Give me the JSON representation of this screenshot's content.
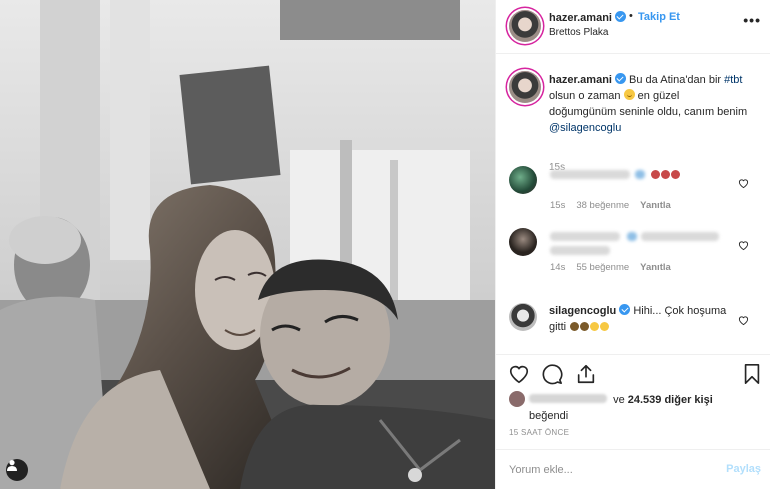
{
  "header": {
    "username": "hazer.amani",
    "separator": "•",
    "follow_label": "Takip Et",
    "location": "Brettos Plaka",
    "more_icon": "more-options-icon"
  },
  "caption": {
    "username": "hazer.amani",
    "text_1": "Bu da Atina'dan bir",
    "hashtag": "#tbt",
    "text_2": "olsun o zaman",
    "text_3": "en güzel doğumgünüm seninle oldu, canım benim",
    "mention": "@silagencoglu",
    "time": "15s"
  },
  "comments": [
    {
      "time": "15s",
      "likes": "38 beğenme",
      "reply": "Yanıtla"
    },
    {
      "time": "14s",
      "likes": "55 beğenme",
      "reply": "Yanıtla"
    },
    {
      "username": "silagencoglu",
      "text": "Hihi... Çok hoşuma gitti"
    }
  ],
  "likes": {
    "conjunction": "ve",
    "count_text": "24.539 diğer kişi",
    "suffix": "beğendi"
  },
  "post_time": "15 SAAT ÖNCE",
  "comment_input": {
    "placeholder": "Yorum ekle..."
  },
  "post_button": "Paylaş",
  "colors": {
    "accent": "#3897f0",
    "text": "#262626",
    "muted": "#8e8e8e",
    "post_disabled": "#b2dffc",
    "story_ring": "#d6249f"
  }
}
